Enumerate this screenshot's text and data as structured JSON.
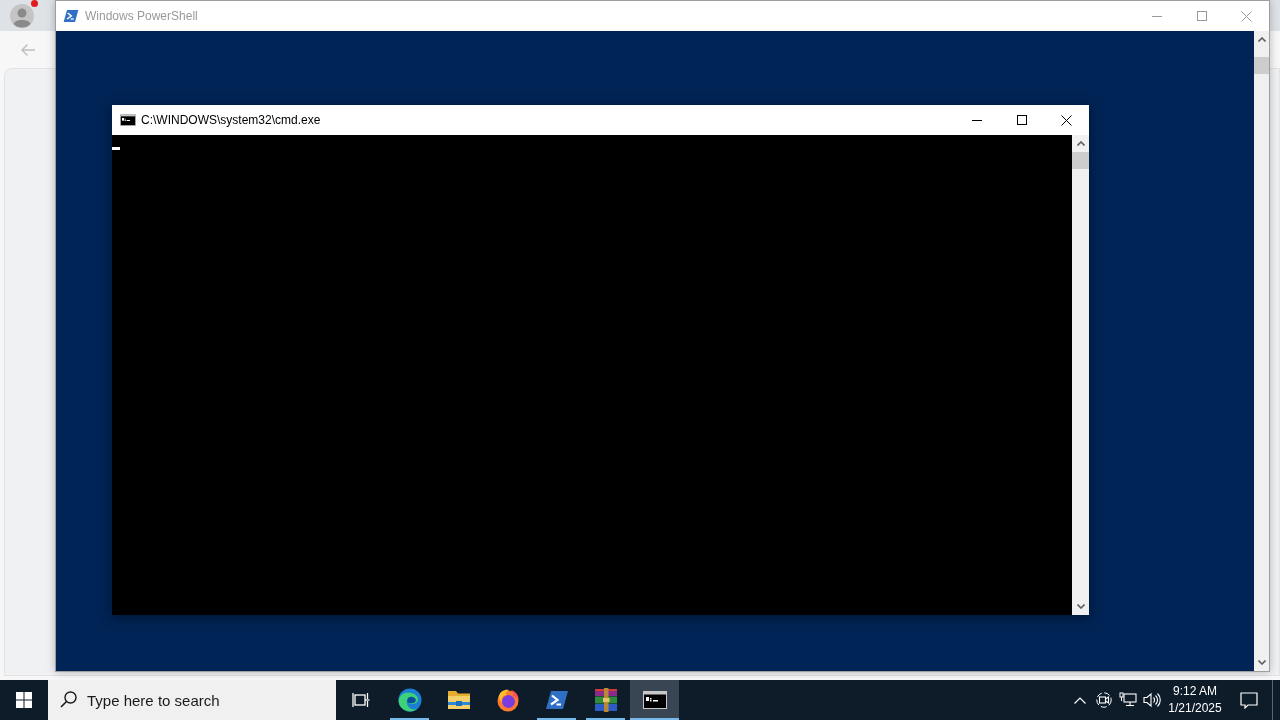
{
  "browser": {
    "profile_notification": true
  },
  "powershell_window": {
    "title": "Windows PowerShell",
    "active": false
  },
  "cmd_window": {
    "title": "C:\\WINDOWS\\system32\\cmd.exe",
    "active": true
  },
  "taskbar": {
    "search": {
      "placeholder": "Type here to search"
    },
    "apps": [
      {
        "kind": "edge",
        "running": true,
        "selected": false
      },
      {
        "kind": "explorer",
        "running": false,
        "selected": false
      },
      {
        "kind": "firefox",
        "running": false,
        "selected": false
      },
      {
        "kind": "powershell",
        "running": true,
        "selected": false
      },
      {
        "kind": "winrar",
        "running": true,
        "selected": false
      },
      {
        "kind": "cmd",
        "running": true,
        "selected": true
      }
    ],
    "clock": {
      "time": "9:12 AM",
      "date": "1/21/2025"
    }
  }
}
